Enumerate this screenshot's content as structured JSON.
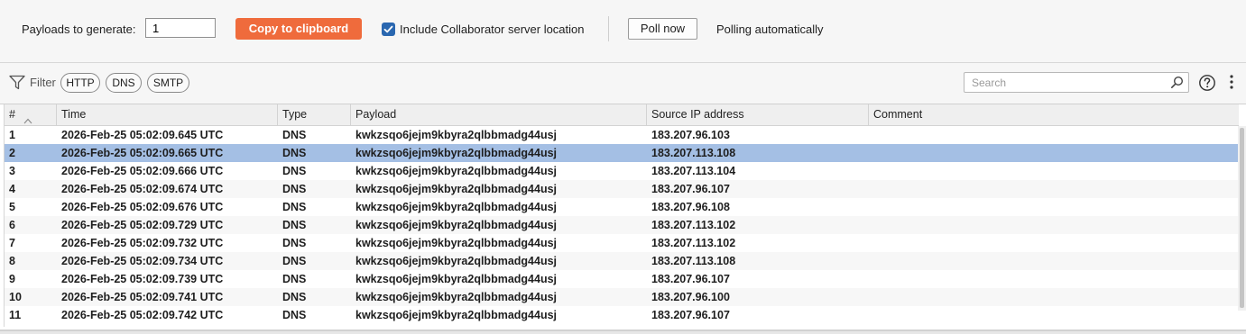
{
  "toolbar": {
    "payloads_label": "Payloads to generate:",
    "payloads_value": "1",
    "copy_label": "Copy to clipboard",
    "include_label": "Include Collaborator server location",
    "include_checked": true,
    "poll_label": "Poll now",
    "polling_status": "Polling automatically",
    "accent_color": "#ef6b3c",
    "checkbox_color": "#2a67b0"
  },
  "filter": {
    "label": "Filter",
    "pills": [
      "HTTP",
      "DNS",
      "SMTP"
    ],
    "search_placeholder": "Search"
  },
  "table": {
    "columns": [
      "#",
      "Time",
      "Type",
      "Payload",
      "Source IP address",
      "Comment"
    ],
    "selected_row": 2,
    "selected_color": "#a4bfe4",
    "rows": [
      [
        "1",
        "2026-Feb-25 05:02:09.645 UTC",
        "DNS",
        "kwkzsqo6jejm9kbyra2qlbbmadg44usj",
        "183.207.96.103",
        ""
      ],
      [
        "2",
        "2026-Feb-25 05:02:09.665 UTC",
        "DNS",
        "kwkzsqo6jejm9kbyra2qlbbmadg44usj",
        "183.207.113.108",
        ""
      ],
      [
        "3",
        "2026-Feb-25 05:02:09.666 UTC",
        "DNS",
        "kwkzsqo6jejm9kbyra2qlbbmadg44usj",
        "183.207.113.104",
        ""
      ],
      [
        "4",
        "2026-Feb-25 05:02:09.674 UTC",
        "DNS",
        "kwkzsqo6jejm9kbyra2qlbbmadg44usj",
        "183.207.96.107",
        ""
      ],
      [
        "5",
        "2026-Feb-25 05:02:09.676 UTC",
        "DNS",
        "kwkzsqo6jejm9kbyra2qlbbmadg44usj",
        "183.207.96.108",
        ""
      ],
      [
        "6",
        "2026-Feb-25 05:02:09.729 UTC",
        "DNS",
        "kwkzsqo6jejm9kbyra2qlbbmadg44usj",
        "183.207.113.102",
        ""
      ],
      [
        "7",
        "2026-Feb-25 05:02:09.732 UTC",
        "DNS",
        "kwkzsqo6jejm9kbyra2qlbbmadg44usj",
        "183.207.113.102",
        ""
      ],
      [
        "8",
        "2026-Feb-25 05:02:09.734 UTC",
        "DNS",
        "kwkzsqo6jejm9kbyra2qlbbmadg44usj",
        "183.207.113.108",
        ""
      ],
      [
        "9",
        "2026-Feb-25 05:02:09.739 UTC",
        "DNS",
        "kwkzsqo6jejm9kbyra2qlbbmadg44usj",
        "183.207.96.107",
        ""
      ],
      [
        "10",
        "2026-Feb-25 05:02:09.741 UTC",
        "DNS",
        "kwkzsqo6jejm9kbyra2qlbbmadg44usj",
        "183.207.96.100",
        ""
      ],
      [
        "11",
        "2026-Feb-25 05:02:09.742 UTC",
        "DNS",
        "kwkzsqo6jejm9kbyra2qlbbmadg44usj",
        "183.207.96.107",
        ""
      ]
    ]
  }
}
